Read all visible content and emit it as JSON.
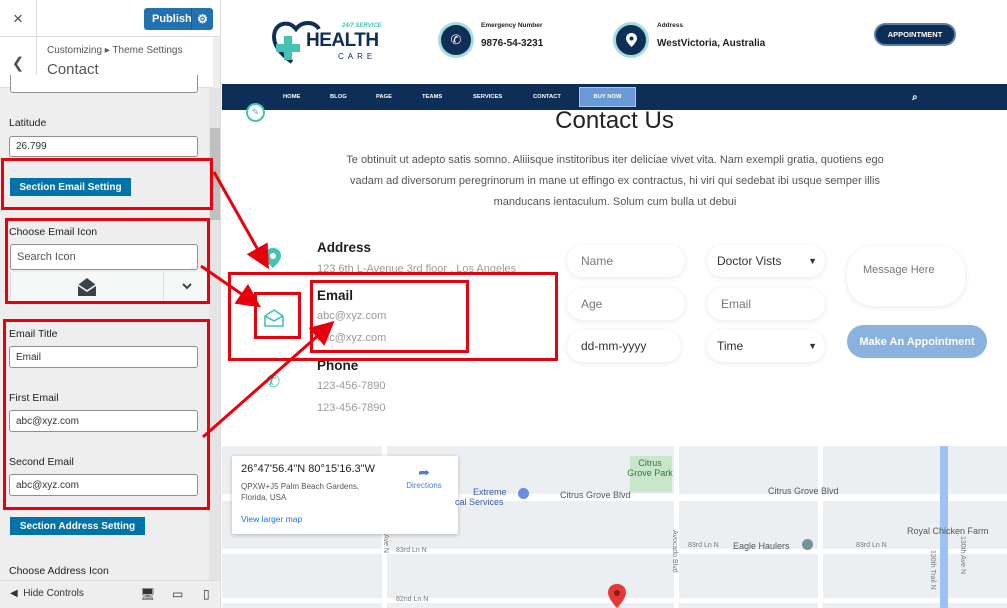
{
  "customizer": {
    "close_icon": "×",
    "publish_label": "Publish",
    "breadcrumb": "Customizing ▸ Theme Settings",
    "section_title": "Contact",
    "latitude_label": "Latitude",
    "latitude_value": "26.799",
    "section_email_button": "Section Email Setting",
    "choose_email_icon_label": "Choose Email Icon",
    "search_icon_placeholder": "Search Icon",
    "email_title_label": "Email Title",
    "email_title_value": "Email",
    "first_email_label": "First Email",
    "first_email_value": "abc@xyz.com",
    "second_email_label": "Second Email",
    "second_email_value": "abc@xyz.com",
    "section_address_button": "Section Address Setting",
    "choose_address_icon_label": "Choose Address Icon",
    "hide_controls_label": "Hide Controls"
  },
  "site": {
    "logo_tag": "24/7 SERVICE",
    "logo_main": "HEALTH",
    "logo_sub": "CARE",
    "emergency_label": "Emergency Number",
    "emergency_value": "9876-54-3231",
    "address_label": "Address",
    "address_value": "WestVictoria, Australia",
    "appointment_button": "APPOINTMENT",
    "nav": [
      "HOME",
      "BLOG",
      "PAGE",
      "TEAMS",
      "SERVICES",
      "CONTACT",
      "BUY NOW"
    ],
    "heading": "Contact Us",
    "lead": "Te obtinuit ut adepto satis somno. Aliiisque institoribus iter deliciae vivet vita. Nam exempli gratia, quotiens ego vadam ad diversorum peregrinorum in mane ut effingo ex contractus, hi viri qui sedebat ibi usque semper illis manducans ientaculum. Solum cum bulla ut debui",
    "address_title": "Address",
    "address_line": "123 6th L-Avenue 3rd floor , Los Angeles",
    "email_title": "Email",
    "email_1": "abc@xyz.com",
    "email_2": "abc@xyz.com",
    "phone_title": "Phone",
    "phone_1": "123-456-7890",
    "phone_2": "123-456-7890"
  },
  "form": {
    "name_placeholder": "Name",
    "doctor_select": "Doctor Vists",
    "message_placeholder": "Message Here",
    "age_placeholder": "Age",
    "email_placeholder": "Email",
    "submit_label": "Make An Appointment",
    "date_placeholder": "dd-mm-yyyy",
    "time_select": "Time"
  },
  "map": {
    "coords": "26°47'56.4\"N 80°15'16.3\"W",
    "place": "QPXW+J5 Palm Beach Gardens, Florida, USA",
    "directions_label": "Directions",
    "larger_map_label": "View larger map",
    "labels": [
      "Citrus Grove Park",
      "Extreme",
      "cal Services",
      "Citrus Grove Blvd",
      "Citrus Grove Blvd",
      "Eagle Haulers",
      "Royal Chicken Farm",
      "83rd Ln N",
      "83rd Ln N",
      "83rd Ln N",
      "82nd Ln N",
      "Avocado Blvd",
      "Ave N",
      "130th Ave N",
      "130th Trail N"
    ]
  },
  "colors": {
    "navy": "#0d2e57",
    "teal": "#44c2b4",
    "wp_blue": "#2271b1",
    "annotation_red": "#e8000d"
  }
}
